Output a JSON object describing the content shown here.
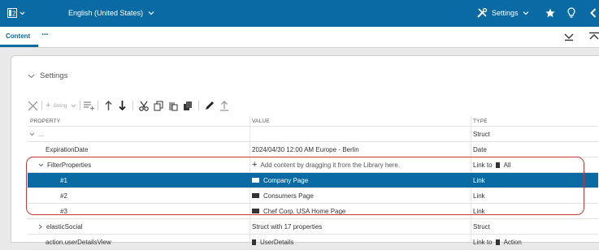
{
  "topbar": {
    "language": "English (United States)",
    "settings_label": "Settings"
  },
  "subbar": {
    "content_tab": "Content",
    "more": "···"
  },
  "panel": {
    "title": "Settings"
  },
  "toolbar": {
    "type_select": "String"
  },
  "table": {
    "headers": [
      "PROPERTY",
      "VALUE",
      "TYPE"
    ],
    "rows": [
      {
        "property": "...",
        "value": "",
        "type": "Struct"
      },
      {
        "property": "ExpirationDate",
        "value": "2024/04/30 12:00 AM Europe - Berlin",
        "type": "Date"
      },
      {
        "property": "FilterProperties",
        "value": "Add content by dragging it from the Library here.",
        "type_prefix": "Link to",
        "type_suffix": "All"
      },
      {
        "property": "#1",
        "value": "Company Page",
        "type": "Link"
      },
      {
        "property": "#2",
        "value": "Consumers Page",
        "type": "Link"
      },
      {
        "property": "#3",
        "value": "Chef Corp. USA Home Page",
        "type": "Link"
      },
      {
        "property": "elasticSocial",
        "value": "Struct with 17 properties",
        "type": "Struct"
      },
      {
        "property": "action.userDetailsView",
        "value": "UserDetails",
        "type_prefix": "Link to",
        "type_suffix": "Action"
      }
    ]
  }
}
